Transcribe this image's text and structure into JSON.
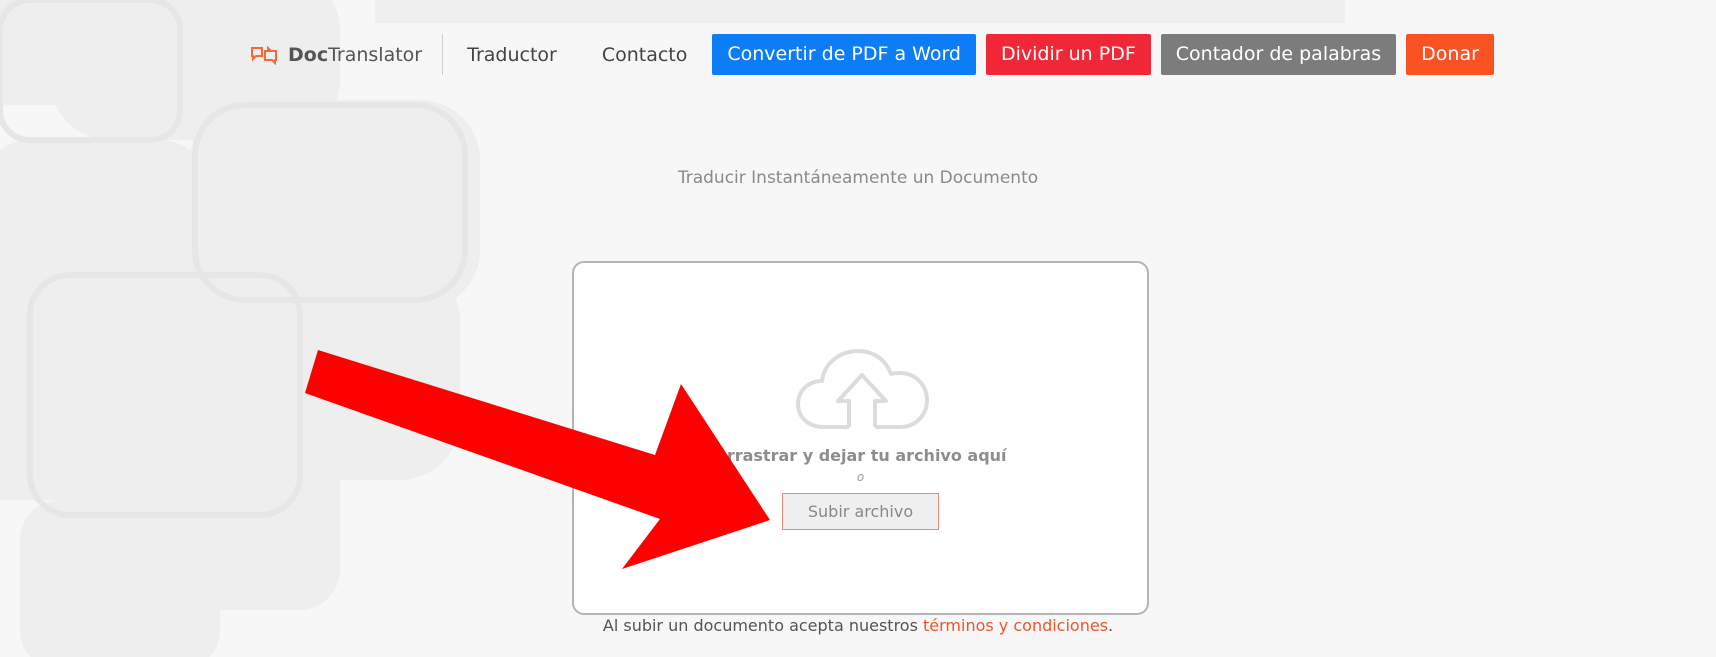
{
  "header": {
    "logo_bold": "Doc",
    "logo_rest": "Translator",
    "nav_links": [
      "Traductor",
      "Contacto"
    ],
    "buttons": [
      {
        "label": "Convertir de PDF a Word",
        "color": "#0c7cf7"
      },
      {
        "label": "Dividir un PDF",
        "color": "#ef2737"
      },
      {
        "label": "Contador de palabras",
        "color": "#7c7c7c"
      },
      {
        "label": "Donar",
        "color": "#fb5223"
      }
    ]
  },
  "main": {
    "subtitle": "Traducir Instantáneamente un Documento",
    "upload": {
      "icon": "cloud-upload-icon",
      "drag_text": "Arrastrar y dejar tu archivo aquí",
      "or_text": "o",
      "button_label": "Subir archivo"
    },
    "terms": {
      "prefix": "Al subir un documento acepta nuestros ",
      "link": "términos y condiciones",
      "suffix": "."
    }
  },
  "annotation": {
    "icon": "red-arrow-icon",
    "color": "#ff0000"
  }
}
